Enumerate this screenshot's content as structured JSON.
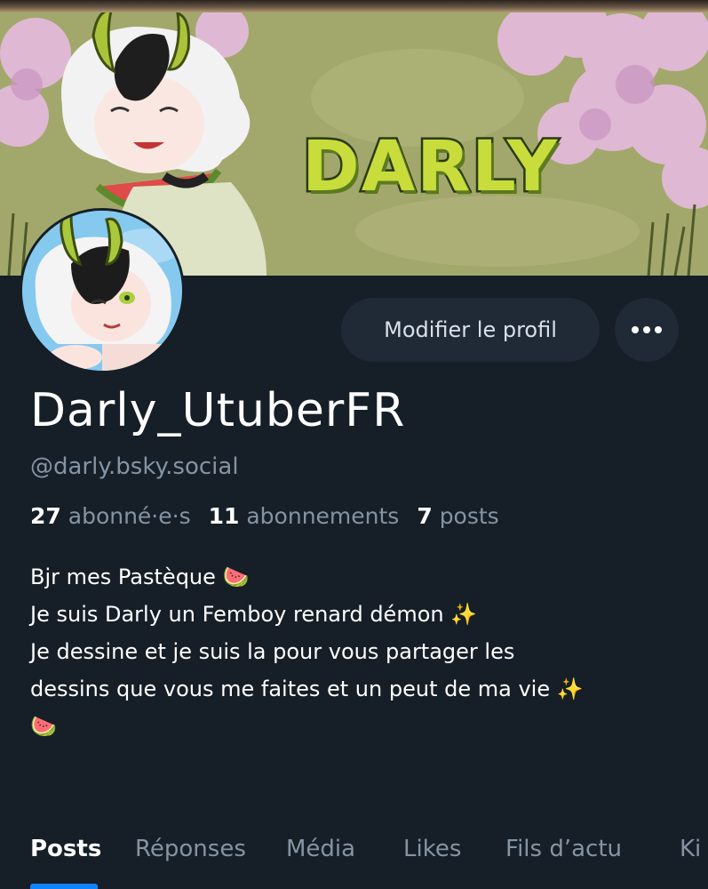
{
  "banner": {
    "title": "DARLY"
  },
  "actions": {
    "edit_profile": "Modifier le profil"
  },
  "profile": {
    "display_name": "Darly_UtuberFR",
    "handle": "@darly.bsky.social",
    "followers_count": "27",
    "followers_label": "abonné·e·s",
    "following_count": "11",
    "following_label": "abonnements",
    "posts_count": "7",
    "posts_label": "posts",
    "bio": [
      "Bjr mes Pastèque 🍉",
      "Je suis Darly un Femboy renard démon ✨",
      "Je dessine et je suis la pour vous partager les",
      "dessins que vous me faites et un peut de ma vie ✨",
      "🍉"
    ]
  },
  "tabs": [
    {
      "label": "Posts",
      "active": true
    },
    {
      "label": "Réponses"
    },
    {
      "label": "Média"
    },
    {
      "label": "Likes"
    },
    {
      "label": "Fils d’actu"
    },
    {
      "label": "Ki"
    }
  ],
  "colors": {
    "background": "#161e27",
    "button_bg": "#1f2a36",
    "muted_text": "#8594a3",
    "accent": "#1083fe"
  }
}
